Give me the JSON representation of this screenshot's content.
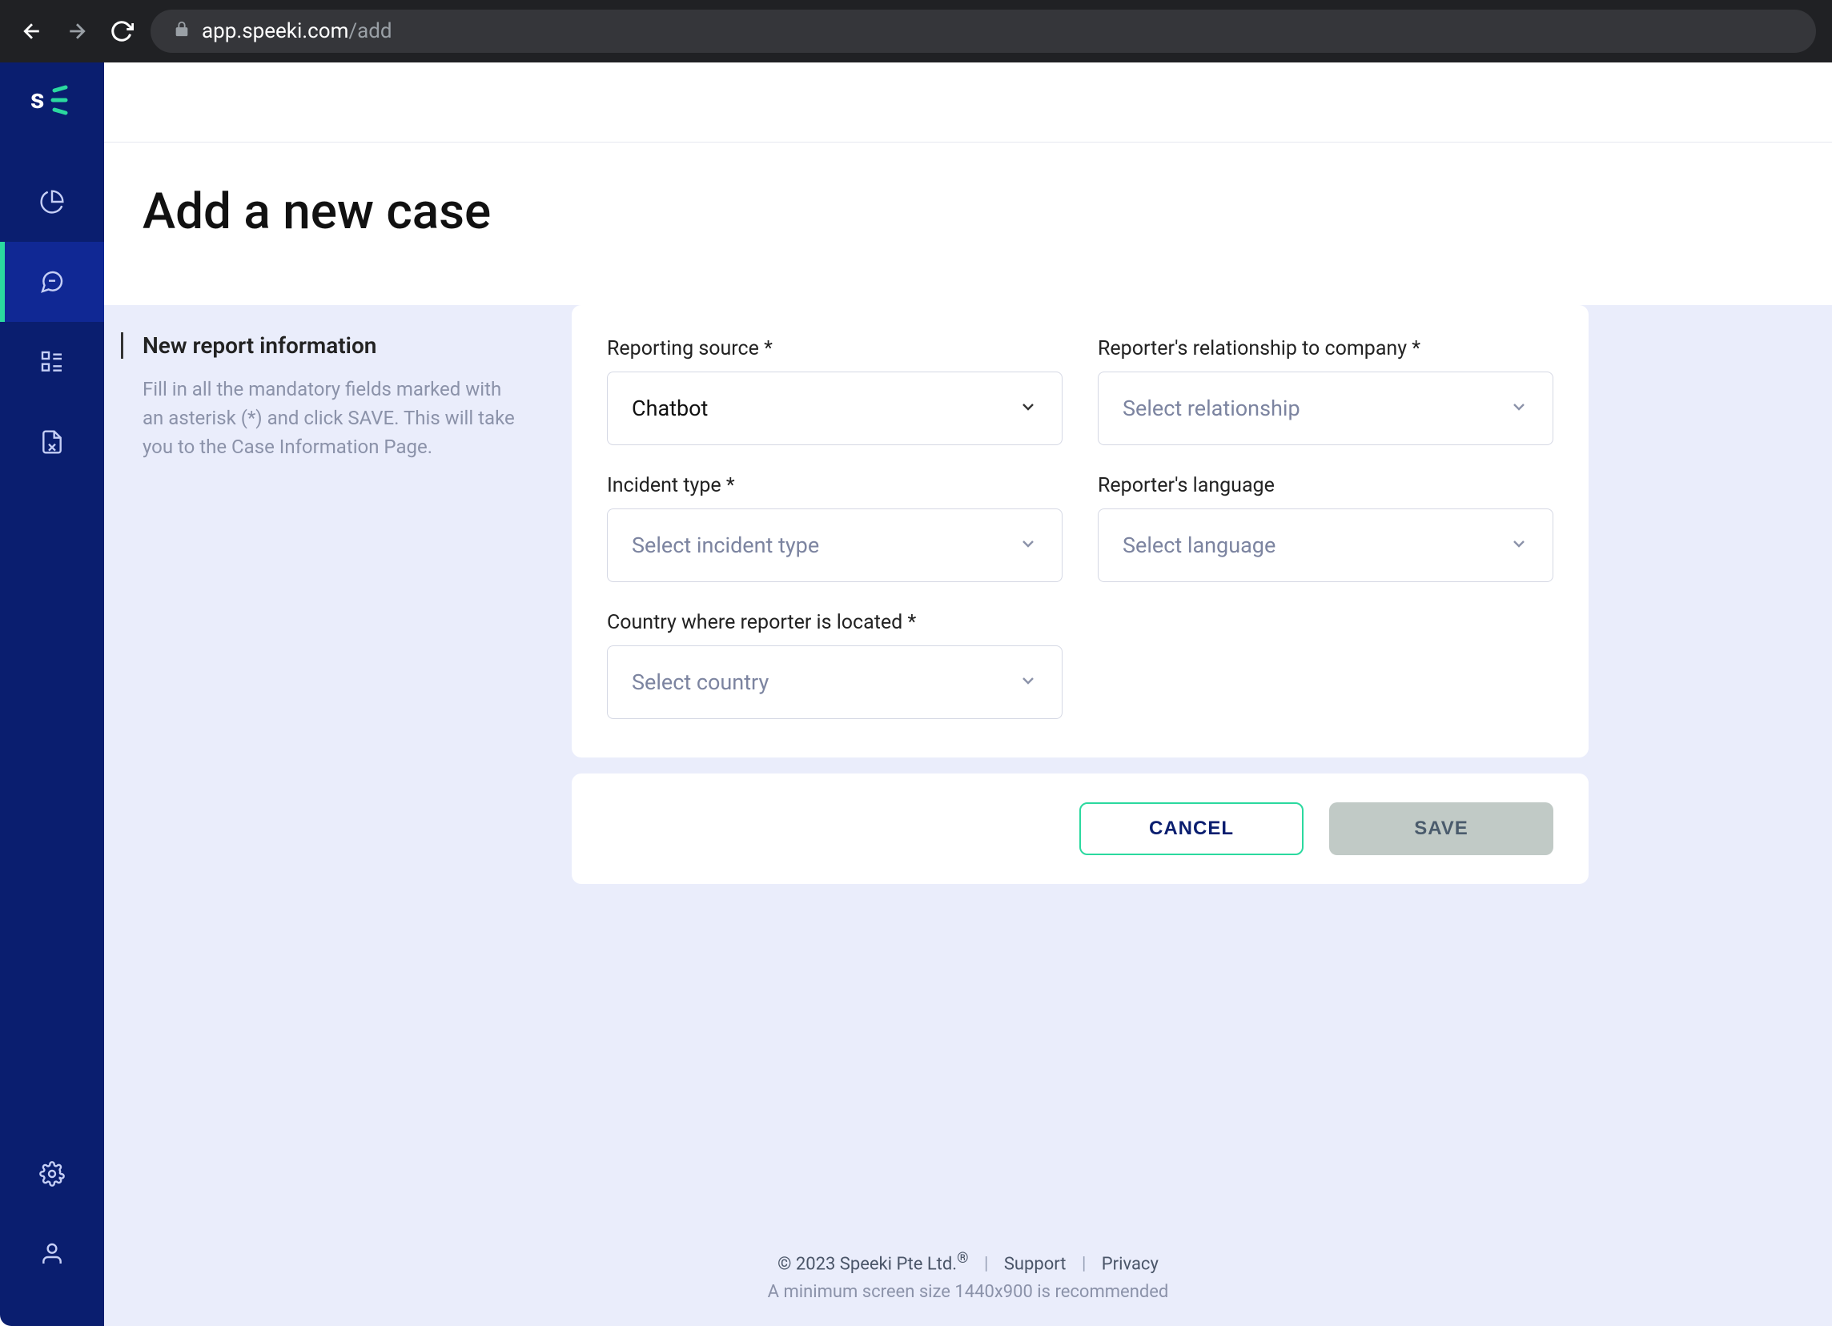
{
  "browser": {
    "url_domain": "app.speeki.com",
    "url_path": "/add"
  },
  "page": {
    "title": "Add a new case"
  },
  "side_panel": {
    "heading": "New report information",
    "description": "Fill in all the mandatory fields marked with an asterisk (*) and click SAVE. This will take you to the Case Information Page."
  },
  "fields": {
    "reporting_source": {
      "label": "Reporting source *",
      "value": "Chatbot"
    },
    "relationship": {
      "label": "Reporter's relationship to company *",
      "placeholder": "Select relationship"
    },
    "incident_type": {
      "label": "Incident type *",
      "placeholder": "Select incident type"
    },
    "language": {
      "label": "Reporter's language",
      "placeholder": "Select language"
    },
    "country": {
      "label": "Country where reporter is located *",
      "placeholder": "Select country"
    }
  },
  "actions": {
    "cancel": "CANCEL",
    "save": "SAVE"
  },
  "footer": {
    "copyright": "© 2023 Speeki Pte Ltd.",
    "support": "Support",
    "privacy": "Privacy",
    "min_size": "A minimum screen size 1440x900 is recommended"
  }
}
